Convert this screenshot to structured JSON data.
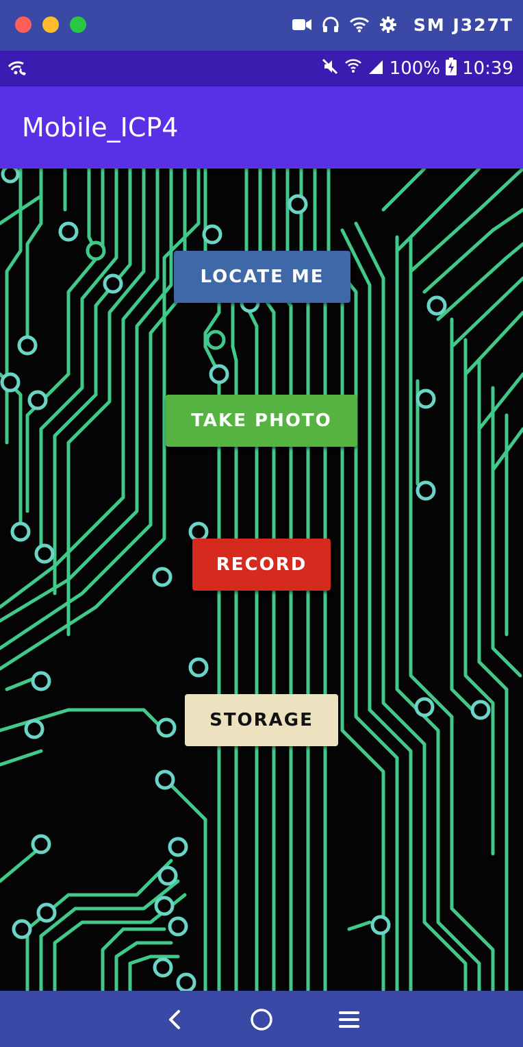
{
  "window": {
    "device_name": "SM J327T",
    "icons": [
      "video-camera-icon",
      "headphones-icon",
      "wifi-icon",
      "gear-icon"
    ]
  },
  "status_bar": {
    "left_icon": "wifi-calling-icon",
    "right_icons": [
      "mute-icon",
      "wifi-signal-icon",
      "cell-signal-icon",
      "battery-charging-icon"
    ],
    "battery": "100%",
    "time": "10:39"
  },
  "app_bar": {
    "title": "Mobile_ICP4"
  },
  "content": {
    "background": "circuit-board-image",
    "buttons": {
      "locate": {
        "label": "LOCATE ME",
        "bg": "#3f68a8",
        "fg": "#ffffff"
      },
      "photo": {
        "label": "TAKE PHOTO",
        "bg": "#55b441",
        "fg": "#ffffff"
      },
      "record": {
        "label": "RECORD",
        "bg": "#d52a1d",
        "fg": "#ffffff"
      },
      "storage": {
        "label": "STORAGE",
        "bg": "#ede2c0",
        "fg": "#111111"
      }
    }
  },
  "nav_bar": {
    "icons": [
      "back-icon",
      "home-icon",
      "recents-icon"
    ]
  },
  "colors": {
    "chrome": "#3a49a6",
    "status_bar": "#3a1cb0",
    "app_bar": "#5a30e6",
    "circuit_trace": "#41c98a"
  }
}
